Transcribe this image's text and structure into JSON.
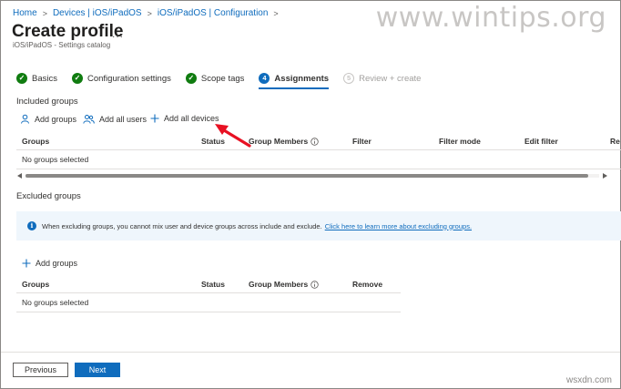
{
  "breadcrumb": [
    "Home",
    "Devices | iOS/iPadOS",
    "iOS/iPadOS | Configuration"
  ],
  "watermark": "www.wintips.org",
  "page": {
    "title": "Create profile",
    "more": "...",
    "subtitle": "iOS/iPadOS - Settings catalog"
  },
  "wizard": {
    "steps": [
      {
        "label": "Basics",
        "state": "done"
      },
      {
        "label": "Configuration settings",
        "state": "done"
      },
      {
        "label": "Scope tags",
        "state": "done"
      },
      {
        "label": "Assignments",
        "state": "current",
        "number": "4"
      },
      {
        "label": "Review + create",
        "state": "disabled",
        "number": "5"
      }
    ]
  },
  "included": {
    "label": "Included groups",
    "commands": {
      "add_groups": "Add groups",
      "add_all_users": "Add all users",
      "add_all_devices": "Add all devices"
    },
    "columns": {
      "groups": "Groups",
      "status": "Status",
      "members": "Group Members",
      "filter": "Filter",
      "filter_mode": "Filter mode",
      "edit_filter": "Edit filter",
      "cut": "Re"
    },
    "empty": "No groups selected"
  },
  "excluded": {
    "label": "Excluded groups",
    "info_text": "When excluding groups, you cannot mix user and device groups across include and exclude.",
    "info_link": "Click here to learn more about excluding groups.",
    "add_groups": "Add groups",
    "columns": {
      "groups": "Groups",
      "status": "Status",
      "members": "Group Members",
      "remove": "Remove"
    },
    "empty": "No groups selected"
  },
  "footer": {
    "previous": "Previous",
    "next": "Next"
  },
  "site_credit": "wsxdn.com",
  "colors": {
    "accent": "#0f6cbd",
    "success": "#107c10",
    "annotation": "#e81123"
  },
  "icons": {
    "step_done": "checkmark-circle-icon",
    "info": "info-icon",
    "add_user": "person-icon",
    "add_users": "people-icon",
    "add": "plus-icon"
  }
}
